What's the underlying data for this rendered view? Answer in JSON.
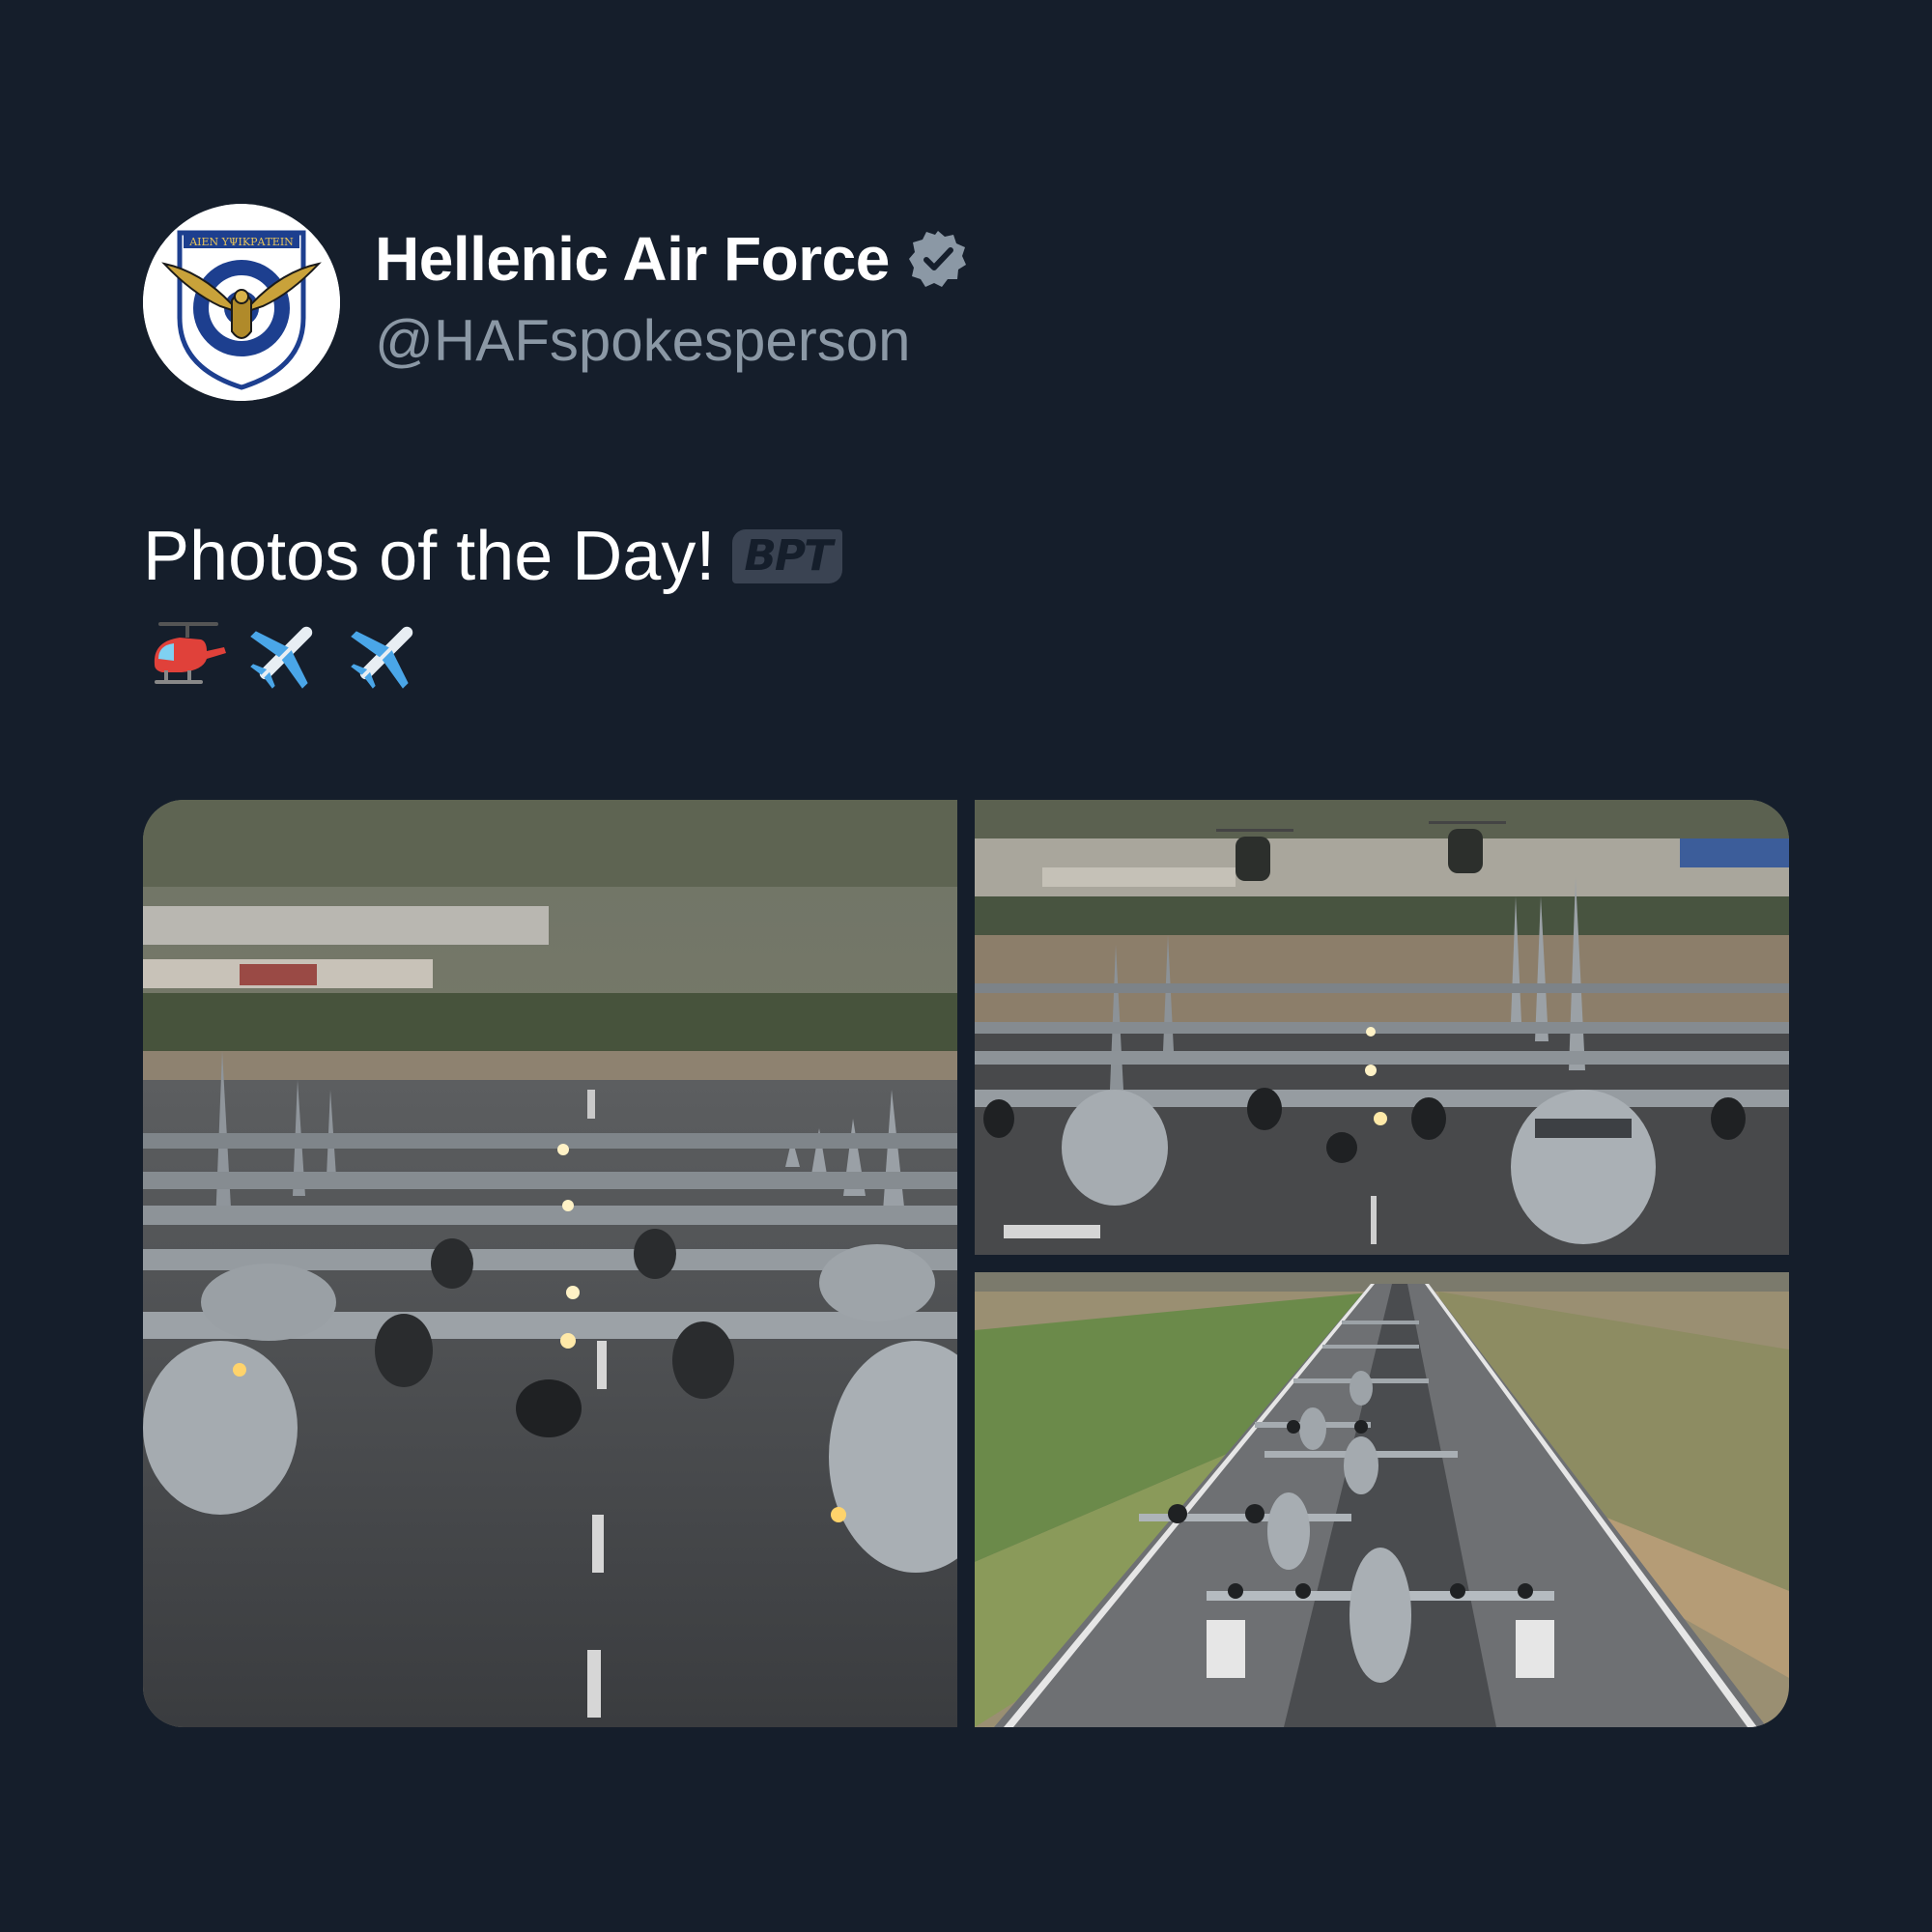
{
  "tweet": {
    "author": {
      "display_name": "Hellenic Air Force",
      "handle": "@HAFspokesperson",
      "verified": true,
      "avatar_icon": "hellenic-air-force-emblem",
      "avatar_motto": "ΑΙΕΝ ΥΨΙΚΡΑΤΕΙΝ"
    },
    "text": "Photos of the Day!",
    "watermark": "BPT",
    "emojis": [
      "helicopter",
      "airplane",
      "airplane"
    ],
    "media": [
      {
        "name": "elephant-walk-closeup",
        "description_icon": "photo"
      },
      {
        "name": "elephant-walk-helicopters",
        "description_icon": "photo"
      },
      {
        "name": "elephant-walk-runway-aerial",
        "description_icon": "photo"
      }
    ]
  },
  "colors": {
    "background": "#151e2b",
    "primary_text": "#ffffff",
    "secondary_text": "#8b98a5",
    "verified_badge": "#8b98a5"
  }
}
